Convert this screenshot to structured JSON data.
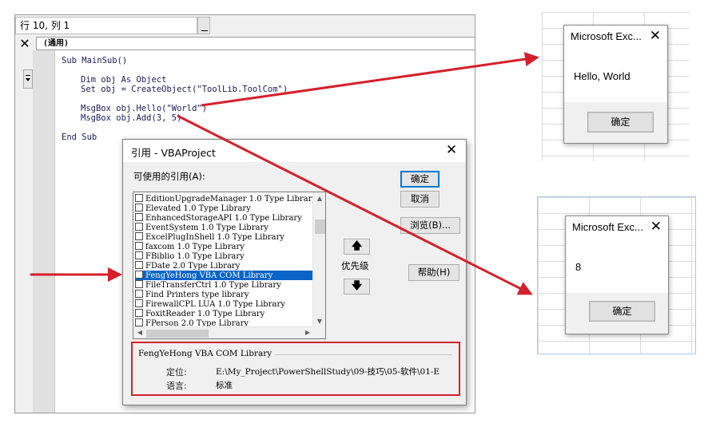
{
  "vbe": {
    "position": "行 10, 列 1",
    "close_glyph": "✕",
    "object_combo": "(通用)",
    "code_lines": [
      "Sub MainSub()",
      "Dim obj As Object",
      "Set obj = CreateObject(\"ToolLib.ToolCom\")",
      "MsgBox obj.Hello(\"World\")",
      "MsgBox obj.Add(3, 5)",
      "End Sub"
    ]
  },
  "references_dialog": {
    "title": "引用 - VBAProject",
    "close_glyph": "✕",
    "available_label": "可使用的引用(A):",
    "items": [
      "EditionUpgradeManager 1.0 Type Library",
      "Elevated 1.0 Type Library",
      "EnhancedStorageAPI 1.0 Type Library",
      "EventSystem 1.0 Type Library",
      "ExcelPlugInShell 1.0 Type Library",
      "faxcom 1.0 Type Library",
      "FBiblio 1.0 Type Library",
      "FDate 2.0 Type Library",
      "FengYeHong VBA COM Library",
      "FileTransferCtrl 1.0 Type Library",
      "Find Printers type library",
      "FirewallCPL LUA 1.0 Type Library",
      "FoxitReader 1.0 Type Library",
      "FPerson 2.0 Type Library"
    ],
    "selected_index": 8,
    "buttons": {
      "ok": "确定",
      "cancel": "取消",
      "browse": "浏览(B)...",
      "help": "帮助(H)"
    },
    "priority_label": "优先级",
    "priority_up": "🡅",
    "priority_down": "🡇",
    "info": {
      "name": "FengYeHong VBA COM Library",
      "location_label": "定位:",
      "location_value": "E:\\My_Project\\PowerShellStudy\\09-技巧\\05-软件\\01-E",
      "language_label": "语言:",
      "language_value": "标准"
    }
  },
  "msgbox1": {
    "title": "Microsoft Exc...",
    "text": "Hello, World",
    "ok": "确定",
    "close_glyph": "✕"
  },
  "msgbox2": {
    "title": "Microsoft Exc...",
    "text": "8",
    "ok": "确定",
    "close_glyph": "✕"
  },
  "colors": {
    "arrow": "#d4202a",
    "selection": "#0a64c8",
    "highlight_box": "#d0242a"
  }
}
